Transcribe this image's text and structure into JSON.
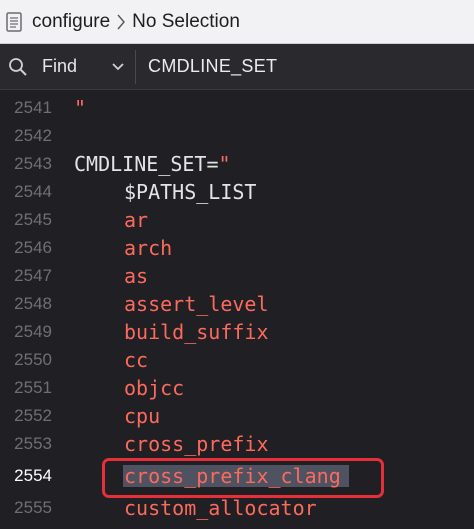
{
  "breadcrumb": {
    "file_name": "configure",
    "selection": "No Selection"
  },
  "find_bar": {
    "mode_label": "Find",
    "query": "CMDLINE_SET"
  },
  "editor": {
    "lines": [
      {
        "number": "2541",
        "text": "\"",
        "kind": "string"
      },
      {
        "number": "2542",
        "text": "",
        "kind": "plain"
      },
      {
        "number": "2543",
        "text": "CMDLINE_SET=\"",
        "kind": "mixed",
        "plain_part": "CMDLINE_SET=",
        "string_part": "\""
      },
      {
        "number": "2544",
        "text": "$PATHS_LIST",
        "kind": "plain"
      },
      {
        "number": "2545",
        "text": "ar",
        "kind": "string"
      },
      {
        "number": "2546",
        "text": "arch",
        "kind": "string"
      },
      {
        "number": "2547",
        "text": "as",
        "kind": "string"
      },
      {
        "number": "2548",
        "text": "assert_level",
        "kind": "string"
      },
      {
        "number": "2549",
        "text": "build_suffix",
        "kind": "string"
      },
      {
        "number": "2550",
        "text": "cc",
        "kind": "string"
      },
      {
        "number": "2551",
        "text": "objcc",
        "kind": "string"
      },
      {
        "number": "2552",
        "text": "cpu",
        "kind": "string"
      },
      {
        "number": "2553",
        "text": "cross_prefix",
        "kind": "string"
      },
      {
        "number": "2554",
        "text": "cross_prefix_clang",
        "kind": "string",
        "current": true
      },
      {
        "number": "2555",
        "text": "custom_allocator",
        "kind": "string"
      }
    ]
  },
  "colors": {
    "string": "#fc6a5d",
    "plain": "#e4e4e4",
    "annotation": "#e5303a"
  }
}
